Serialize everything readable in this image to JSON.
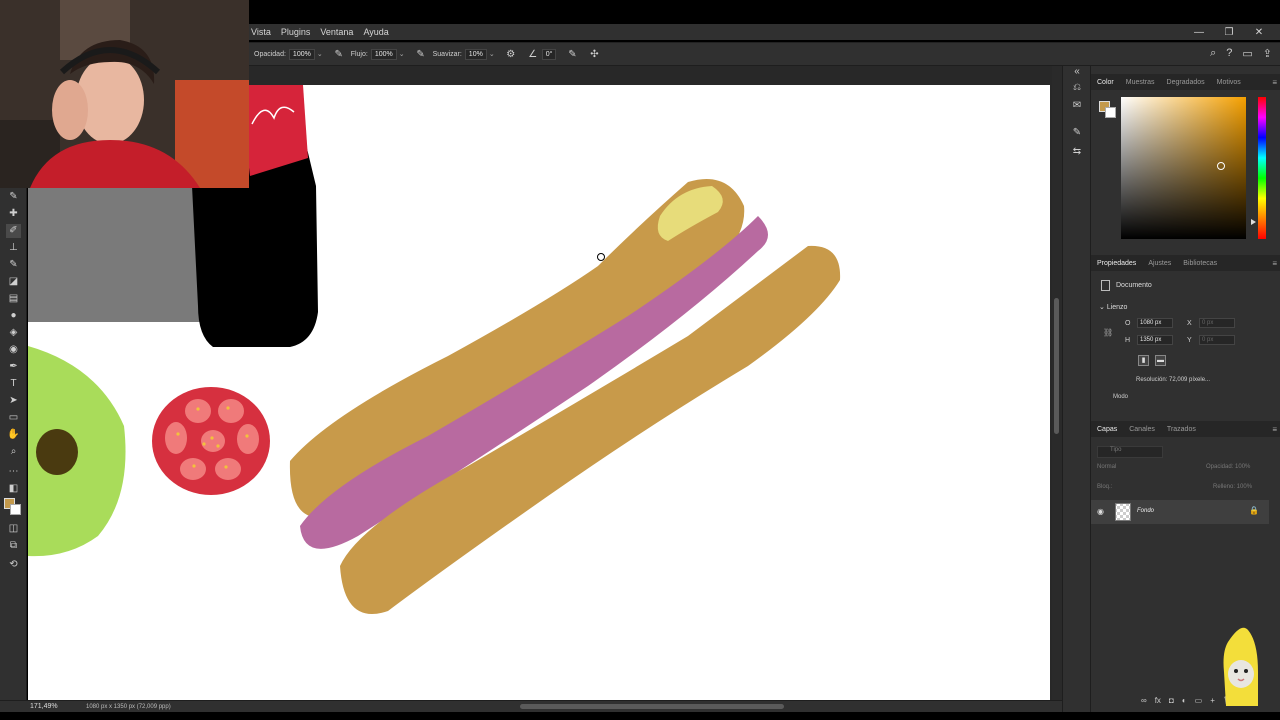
{
  "menu": {
    "items": [
      "Vista",
      "Plugins",
      "Ventana",
      "Ayuda"
    ]
  },
  "window_controls": [
    "—",
    "❐",
    "✕"
  ],
  "options": {
    "opacity_label": "Opacidad:",
    "opacity_value": "100%",
    "flow_label": "Flujo:",
    "flow_value": "100%",
    "smoothing_label": "Suavizar:",
    "smoothing_value": "10%",
    "angle_value": "0°"
  },
  "status": {
    "zoom": "171,49%",
    "doc_info": "1080 px x 1350 px (72,009 ppp)"
  },
  "color_panel": {
    "tabs": [
      "Color",
      "Muestras",
      "Degradados",
      "Motivos"
    ],
    "foreground": "#c49a4c",
    "background": "#ffffff"
  },
  "properties_panel": {
    "tabs": [
      "Propiedades",
      "Ajustes",
      "Bibliotecas"
    ],
    "doc_label": "Documento",
    "canvas_label": "Lienzo",
    "w_label": "O",
    "w_value": "1080 px",
    "h_label": "H",
    "h_value": "1350 px",
    "x_label": "X",
    "x_value": "0 px",
    "y_label": "Y",
    "y_value": "0 px",
    "resolution": "Resolución: 72,009 píxele...",
    "mode_label": "Modo"
  },
  "layers_panel": {
    "tabs": [
      "Capas",
      "Canales",
      "Trazados"
    ],
    "search_placeholder": "Tipo",
    "blend_mode": "Normal",
    "opacity_label": "Opacidad: 100%",
    "lock_label": "Bloq.:",
    "fill_label": "Relleno: 100%",
    "layer_name": "Fondo"
  }
}
